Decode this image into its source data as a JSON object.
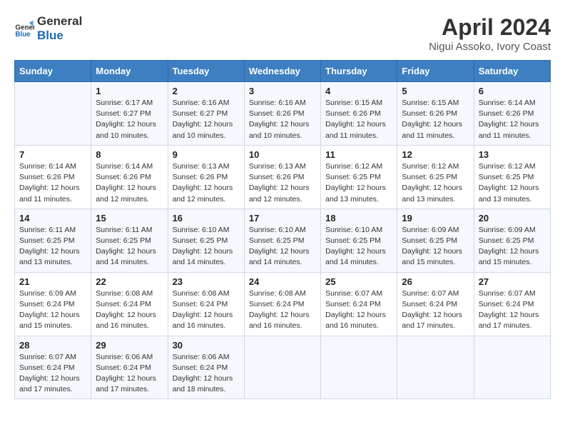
{
  "logo": {
    "line1": "General",
    "line2": "Blue"
  },
  "title": "April 2024",
  "subtitle": "Nigui Assoko, Ivory Coast",
  "days_header": [
    "Sunday",
    "Monday",
    "Tuesday",
    "Wednesday",
    "Thursday",
    "Friday",
    "Saturday"
  ],
  "weeks": [
    [
      {
        "day": "",
        "info": ""
      },
      {
        "day": "1",
        "info": "Sunrise: 6:17 AM\nSunset: 6:27 PM\nDaylight: 12 hours\nand 10 minutes."
      },
      {
        "day": "2",
        "info": "Sunrise: 6:16 AM\nSunset: 6:27 PM\nDaylight: 12 hours\nand 10 minutes."
      },
      {
        "day": "3",
        "info": "Sunrise: 6:16 AM\nSunset: 6:26 PM\nDaylight: 12 hours\nand 10 minutes."
      },
      {
        "day": "4",
        "info": "Sunrise: 6:15 AM\nSunset: 6:26 PM\nDaylight: 12 hours\nand 11 minutes."
      },
      {
        "day": "5",
        "info": "Sunrise: 6:15 AM\nSunset: 6:26 PM\nDaylight: 12 hours\nand 11 minutes."
      },
      {
        "day": "6",
        "info": "Sunrise: 6:14 AM\nSunset: 6:26 PM\nDaylight: 12 hours\nand 11 minutes."
      }
    ],
    [
      {
        "day": "7",
        "info": "Sunrise: 6:14 AM\nSunset: 6:26 PM\nDaylight: 12 hours\nand 11 minutes."
      },
      {
        "day": "8",
        "info": "Sunrise: 6:14 AM\nSunset: 6:26 PM\nDaylight: 12 hours\nand 12 minutes."
      },
      {
        "day": "9",
        "info": "Sunrise: 6:13 AM\nSunset: 6:26 PM\nDaylight: 12 hours\nand 12 minutes."
      },
      {
        "day": "10",
        "info": "Sunrise: 6:13 AM\nSunset: 6:26 PM\nDaylight: 12 hours\nand 12 minutes."
      },
      {
        "day": "11",
        "info": "Sunrise: 6:12 AM\nSunset: 6:25 PM\nDaylight: 12 hours\nand 13 minutes."
      },
      {
        "day": "12",
        "info": "Sunrise: 6:12 AM\nSunset: 6:25 PM\nDaylight: 12 hours\nand 13 minutes."
      },
      {
        "day": "13",
        "info": "Sunrise: 6:12 AM\nSunset: 6:25 PM\nDaylight: 12 hours\nand 13 minutes."
      }
    ],
    [
      {
        "day": "14",
        "info": "Sunrise: 6:11 AM\nSunset: 6:25 PM\nDaylight: 12 hours\nand 13 minutes."
      },
      {
        "day": "15",
        "info": "Sunrise: 6:11 AM\nSunset: 6:25 PM\nDaylight: 12 hours\nand 14 minutes."
      },
      {
        "day": "16",
        "info": "Sunrise: 6:10 AM\nSunset: 6:25 PM\nDaylight: 12 hours\nand 14 minutes."
      },
      {
        "day": "17",
        "info": "Sunrise: 6:10 AM\nSunset: 6:25 PM\nDaylight: 12 hours\nand 14 minutes."
      },
      {
        "day": "18",
        "info": "Sunrise: 6:10 AM\nSunset: 6:25 PM\nDaylight: 12 hours\nand 14 minutes."
      },
      {
        "day": "19",
        "info": "Sunrise: 6:09 AM\nSunset: 6:25 PM\nDaylight: 12 hours\nand 15 minutes."
      },
      {
        "day": "20",
        "info": "Sunrise: 6:09 AM\nSunset: 6:25 PM\nDaylight: 12 hours\nand 15 minutes."
      }
    ],
    [
      {
        "day": "21",
        "info": "Sunrise: 6:09 AM\nSunset: 6:24 PM\nDaylight: 12 hours\nand 15 minutes."
      },
      {
        "day": "22",
        "info": "Sunrise: 6:08 AM\nSunset: 6:24 PM\nDaylight: 12 hours\nand 16 minutes."
      },
      {
        "day": "23",
        "info": "Sunrise: 6:08 AM\nSunset: 6:24 PM\nDaylight: 12 hours\nand 16 minutes."
      },
      {
        "day": "24",
        "info": "Sunrise: 6:08 AM\nSunset: 6:24 PM\nDaylight: 12 hours\nand 16 minutes."
      },
      {
        "day": "25",
        "info": "Sunrise: 6:07 AM\nSunset: 6:24 PM\nDaylight: 12 hours\nand 16 minutes."
      },
      {
        "day": "26",
        "info": "Sunrise: 6:07 AM\nSunset: 6:24 PM\nDaylight: 12 hours\nand 17 minutes."
      },
      {
        "day": "27",
        "info": "Sunrise: 6:07 AM\nSunset: 6:24 PM\nDaylight: 12 hours\nand 17 minutes."
      }
    ],
    [
      {
        "day": "28",
        "info": "Sunrise: 6:07 AM\nSunset: 6:24 PM\nDaylight: 12 hours\nand 17 minutes."
      },
      {
        "day": "29",
        "info": "Sunrise: 6:06 AM\nSunset: 6:24 PM\nDaylight: 12 hours\nand 17 minutes."
      },
      {
        "day": "30",
        "info": "Sunrise: 6:06 AM\nSunset: 6:24 PM\nDaylight: 12 hours\nand 18 minutes."
      },
      {
        "day": "",
        "info": ""
      },
      {
        "day": "",
        "info": ""
      },
      {
        "day": "",
        "info": ""
      },
      {
        "day": "",
        "info": ""
      }
    ]
  ]
}
